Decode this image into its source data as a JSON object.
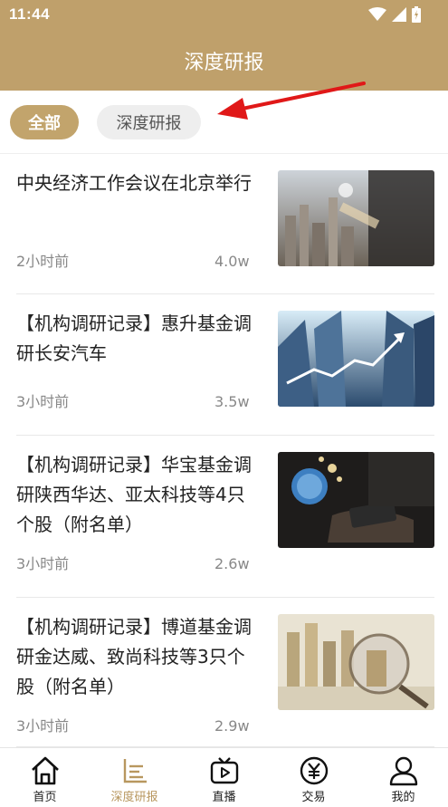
{
  "status": {
    "time": "11:44"
  },
  "header": {
    "title": "深度研报"
  },
  "filters": [
    {
      "label": "全部",
      "active": true
    },
    {
      "label": "深度研报",
      "active": false
    }
  ],
  "articles": [
    {
      "title": "中央经济工作会议在北京举行",
      "time": "2小时前",
      "views": "4.0w"
    },
    {
      "title": "【机构调研记录】惠升基金调研长安汽车",
      "time": "3小时前",
      "views": "3.5w"
    },
    {
      "title": "【机构调研记录】华宝基金调研陕西华达、亚太科技等4只个股（附名单）",
      "time": "3小时前",
      "views": "2.6w"
    },
    {
      "title": "【机构调研记录】博道基金调研金达威、致尚科技等3只个股（附名单）",
      "time": "3小时前",
      "views": "2.9w"
    }
  ],
  "tabbar": [
    {
      "label": "首页",
      "icon": "home-icon"
    },
    {
      "label": "深度研报",
      "icon": "bar-chart-icon",
      "active": true
    },
    {
      "label": "直播",
      "icon": "tv-icon"
    },
    {
      "label": "交易",
      "icon": "yen-icon"
    },
    {
      "label": "我的",
      "icon": "user-icon"
    }
  ],
  "colors": {
    "accent": "#bfa06b",
    "active_tab": "#b8975f"
  }
}
